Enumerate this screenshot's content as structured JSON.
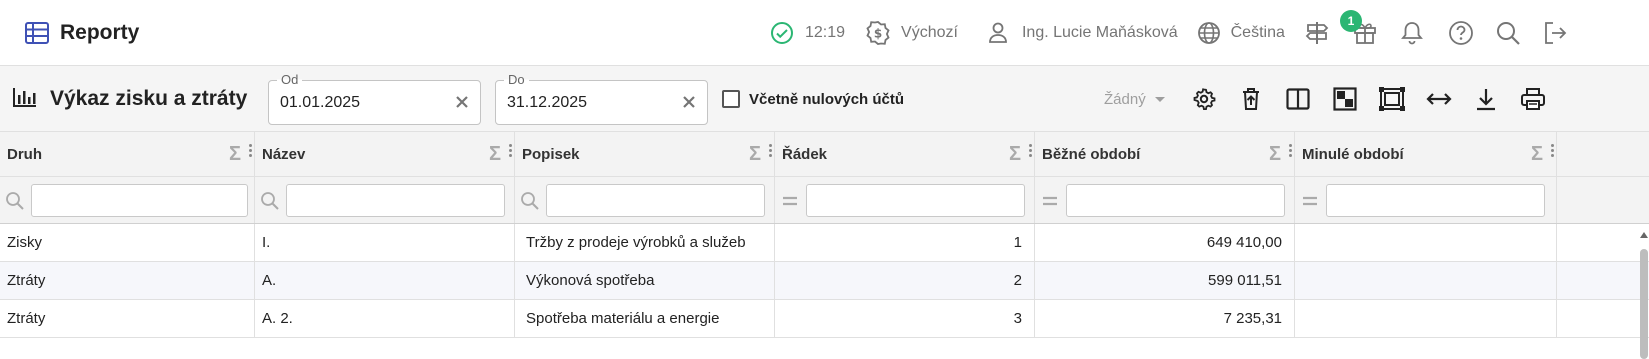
{
  "topbar": {
    "title": "Reporty",
    "time": "12:19",
    "company": "Výchozí",
    "user": "Ing. Lucie Maňásková",
    "language": "Čeština",
    "gift_badge": "1"
  },
  "toolbar": {
    "title": "Výkaz zisku a ztráty",
    "date_from": {
      "label": "Od",
      "value": "01.01.2025"
    },
    "date_to": {
      "label": "Do",
      "value": "31.12.2025"
    },
    "include_zero_label": "Včetně nulových účtů",
    "layout_select": "Žádný"
  },
  "grid": {
    "columns": [
      "Druh",
      "Název",
      "Popisek",
      "Řádek",
      "Běžné období",
      "Minulé období"
    ],
    "rows": [
      [
        "Zisky",
        "I.",
        "Tržby z prodeje výrobků a služeb",
        "1",
        "649 410,00",
        ""
      ],
      [
        "Ztráty",
        "A.",
        "Výkonová spotřeba",
        "2",
        "599 011,51",
        ""
      ],
      [
        "Ztráty",
        "A. 2.",
        "Spotřeba materiálu a energie",
        "3",
        "7 235,31",
        ""
      ]
    ]
  },
  "colors": {
    "accent": "#3f51b5",
    "success": "#2bb673",
    "icon": "#757575"
  }
}
